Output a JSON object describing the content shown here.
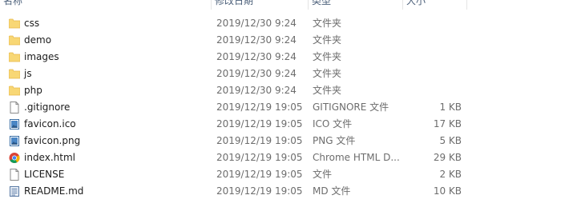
{
  "header": {
    "name": "名称",
    "date_modified": "修改日期",
    "type": "类型",
    "size": "大小"
  },
  "files": [
    {
      "name": "css",
      "date": "2019/12/30 9:24",
      "type": "文件夹",
      "size": "",
      "icon": "folder-icon"
    },
    {
      "name": "demo",
      "date": "2019/12/30 9:24",
      "type": "文件夹",
      "size": "",
      "icon": "folder-icon"
    },
    {
      "name": "images",
      "date": "2019/12/30 9:24",
      "type": "文件夹",
      "size": "",
      "icon": "folder-icon"
    },
    {
      "name": "js",
      "date": "2019/12/30 9:24",
      "type": "文件夹",
      "size": "",
      "icon": "folder-icon"
    },
    {
      "name": "php",
      "date": "2019/12/30 9:24",
      "type": "文件夹",
      "size": "",
      "icon": "folder-icon"
    },
    {
      "name": ".gitignore",
      "date": "2019/12/19 19:05",
      "type": "GITIGNORE 文件",
      "size": "1 KB",
      "icon": "blank-file-icon"
    },
    {
      "name": "favicon.ico",
      "date": "2019/12/19 19:05",
      "type": "ICO 文件",
      "size": "17 KB",
      "icon": "image-file-icon"
    },
    {
      "name": "favicon.png",
      "date": "2019/12/19 19:05",
      "type": "PNG 文件",
      "size": "5 KB",
      "icon": "image-file-icon"
    },
    {
      "name": "index.html",
      "date": "2019/12/19 19:05",
      "type": "Chrome HTML D...",
      "size": "29 KB",
      "icon": "chrome-icon"
    },
    {
      "name": "LICENSE",
      "date": "2019/12/19 19:05",
      "type": "文件",
      "size": "2 KB",
      "icon": "blank-file-icon"
    },
    {
      "name": "README.md",
      "date": "2019/12/19 19:05",
      "type": "MD 文件",
      "size": "10 KB",
      "icon": "markdown-file-icon"
    }
  ],
  "colors": {
    "folder": "#f8d775",
    "folder_dark": "#e6b84a",
    "text": "#1b1b1b",
    "muted": "#6d6d6d",
    "header_text": "#4c607a"
  }
}
